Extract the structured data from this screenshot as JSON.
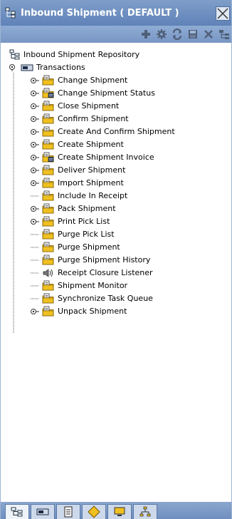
{
  "window": {
    "title": "Inbound Shipment ( DEFAULT )"
  },
  "toolbar": {
    "icons": [
      "add-icon",
      "settings-gear-icon",
      "refresh-icon",
      "save-icon",
      "delete-icon",
      "tree-icon"
    ]
  },
  "tree": {
    "root_label": "Inbound Shipment Repository",
    "transactions_label": "Transactions",
    "items": [
      {
        "label": "Change Shipment",
        "expandable": true,
        "icon": "folder-icon"
      },
      {
        "label": "Change Shipment Status",
        "expandable": true,
        "icon": "folder-doc-icon"
      },
      {
        "label": "Close Shipment",
        "expandable": true,
        "icon": "folder-icon"
      },
      {
        "label": "Confirm Shipment",
        "expandable": true,
        "icon": "folder-icon"
      },
      {
        "label": "Create And Confirm Shipment",
        "expandable": true,
        "icon": "folder-icon"
      },
      {
        "label": "Create Shipment",
        "expandable": true,
        "icon": "folder-icon"
      },
      {
        "label": "Create Shipment Invoice",
        "expandable": true,
        "icon": "folder-doc-icon"
      },
      {
        "label": "Deliver Shipment",
        "expandable": true,
        "icon": "folder-icon"
      },
      {
        "label": "Import Shipment",
        "expandable": true,
        "icon": "folder-icon"
      },
      {
        "label": "Include In Receipt",
        "expandable": false,
        "icon": "folder-icon"
      },
      {
        "label": "Pack Shipment",
        "expandable": true,
        "icon": "folder-icon"
      },
      {
        "label": "Print Pick List",
        "expandable": true,
        "icon": "folder-icon"
      },
      {
        "label": "Purge Pick List",
        "expandable": false,
        "icon": "folder-icon"
      },
      {
        "label": "Purge Shipment",
        "expandable": false,
        "icon": "folder-icon"
      },
      {
        "label": "Purge Shipment History",
        "expandable": false,
        "icon": "folder-icon"
      },
      {
        "label": "Receipt Closure Listener",
        "expandable": false,
        "icon": "speaker-icon"
      },
      {
        "label": "Shipment Monitor",
        "expandable": false,
        "icon": "folder-icon"
      },
      {
        "label": "Synchronize Task Queue",
        "expandable": false,
        "icon": "folder-icon"
      },
      {
        "label": "Unpack Shipment",
        "expandable": true,
        "icon": "folder-icon"
      }
    ]
  },
  "bottom_tabs": {
    "icons": [
      "tree-view-tab-icon",
      "component-tab-icon",
      "document-tab-icon",
      "diamond-tab-icon",
      "monitor-tab-icon",
      "network-tab-icon"
    ]
  },
  "colors": {
    "titlebar": "#6f8fc1",
    "toolbar": "#83a1cc",
    "folder": "#f0c020",
    "expander": "#3a3a3a"
  }
}
